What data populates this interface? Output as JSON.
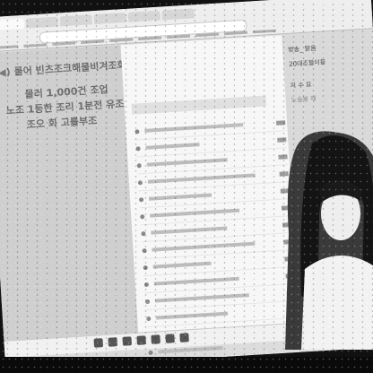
{
  "overlay": {
    "title": "물어 빈츠조크해물비겨조회",
    "line1": "물러 1,000건 조업",
    "line2": "노조 1등한 조리 1분전 유조 조선 2회",
    "line3": "조오 회 고를부조"
  },
  "sidebar": {
    "item1": "방송_ 맑음",
    "item2": "20대조할이용",
    "item3": "지 수 요",
    "item4": "노슬봉 제"
  }
}
